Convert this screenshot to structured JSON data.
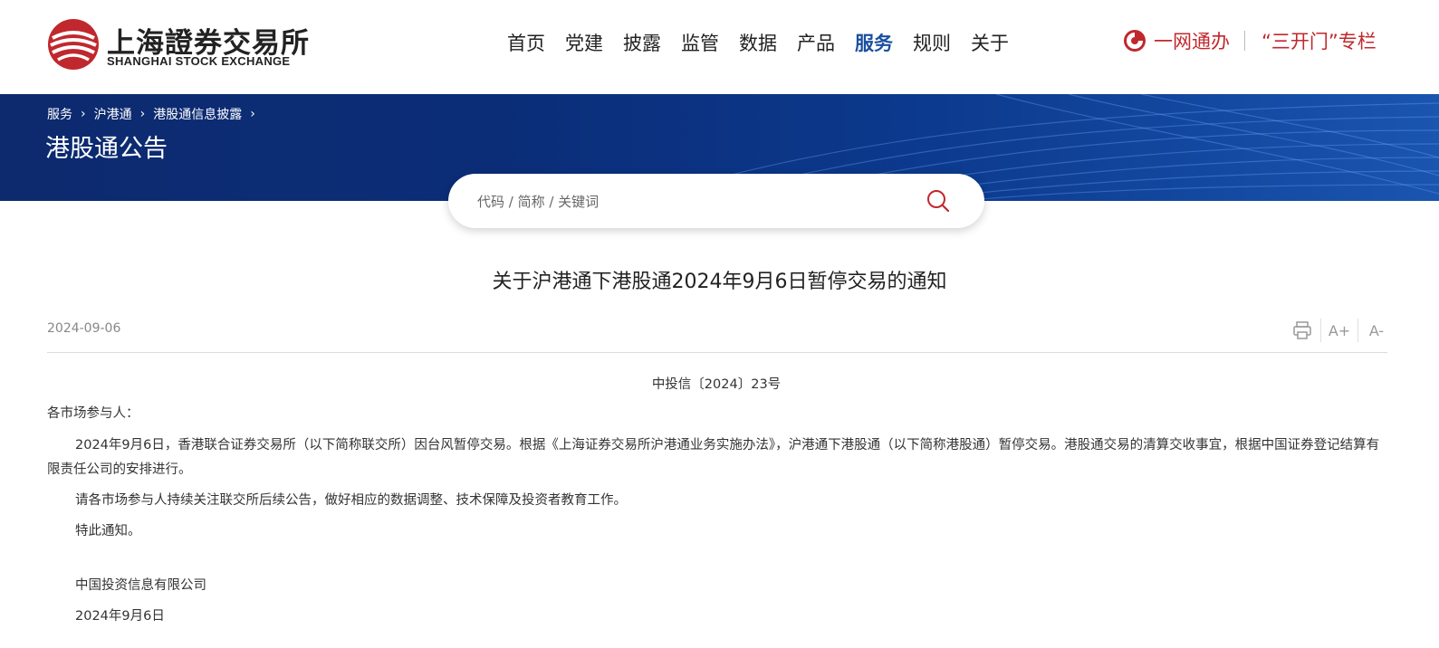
{
  "logo": {
    "cn": "上海證券交易所",
    "en": "SHANGHAI STOCK EXCHANGE"
  },
  "nav": [
    {
      "label": "首页"
    },
    {
      "label": "党建"
    },
    {
      "label": "披露"
    },
    {
      "label": "监管"
    },
    {
      "label": "数据"
    },
    {
      "label": "产品"
    },
    {
      "label": "服务",
      "active": true
    },
    {
      "label": "规则"
    },
    {
      "label": "关于"
    }
  ],
  "right_links": {
    "ywt": "一网通办",
    "skm": "“三开门”专栏"
  },
  "breadcrumb": [
    "服务",
    "沪港通",
    "港股通信息披露"
  ],
  "page_title": "港股通公告",
  "search": {
    "placeholder": "代码 / 简称 / 关键词"
  },
  "article": {
    "title": "关于沪港通下港股通2024年9月6日暂停交易的通知",
    "date": "2024-09-06",
    "tools": {
      "print": "print-icon",
      "font_up": "A+",
      "font_down": "A-"
    },
    "doc_no": "中投信〔2024〕23号",
    "salutation": "各市场参与人：",
    "body1": "2024年9月6日，香港联合证券交易所（以下简称联交所）因台风暂停交易。根据《上海证券交易所沪港通业务实施办法》，沪港通下港股通（以下简称港股通）暂停交易。港股通交易的清算交收事宜，根据中国证券登记结算有限责任公司的安排进行。",
    "body2": "请各市场参与人持续关注联交所后续公告，做好相应的数据调整、技术保障及投资者教育工作。",
    "closing": "特此通知。",
    "signature": "中国投资信息有限公司",
    "sign_date": "2024年9月6日"
  },
  "colors": {
    "brand_red": "#c0282d",
    "nav_active": "#1a4fa0",
    "banner": "#0d2a6e"
  }
}
